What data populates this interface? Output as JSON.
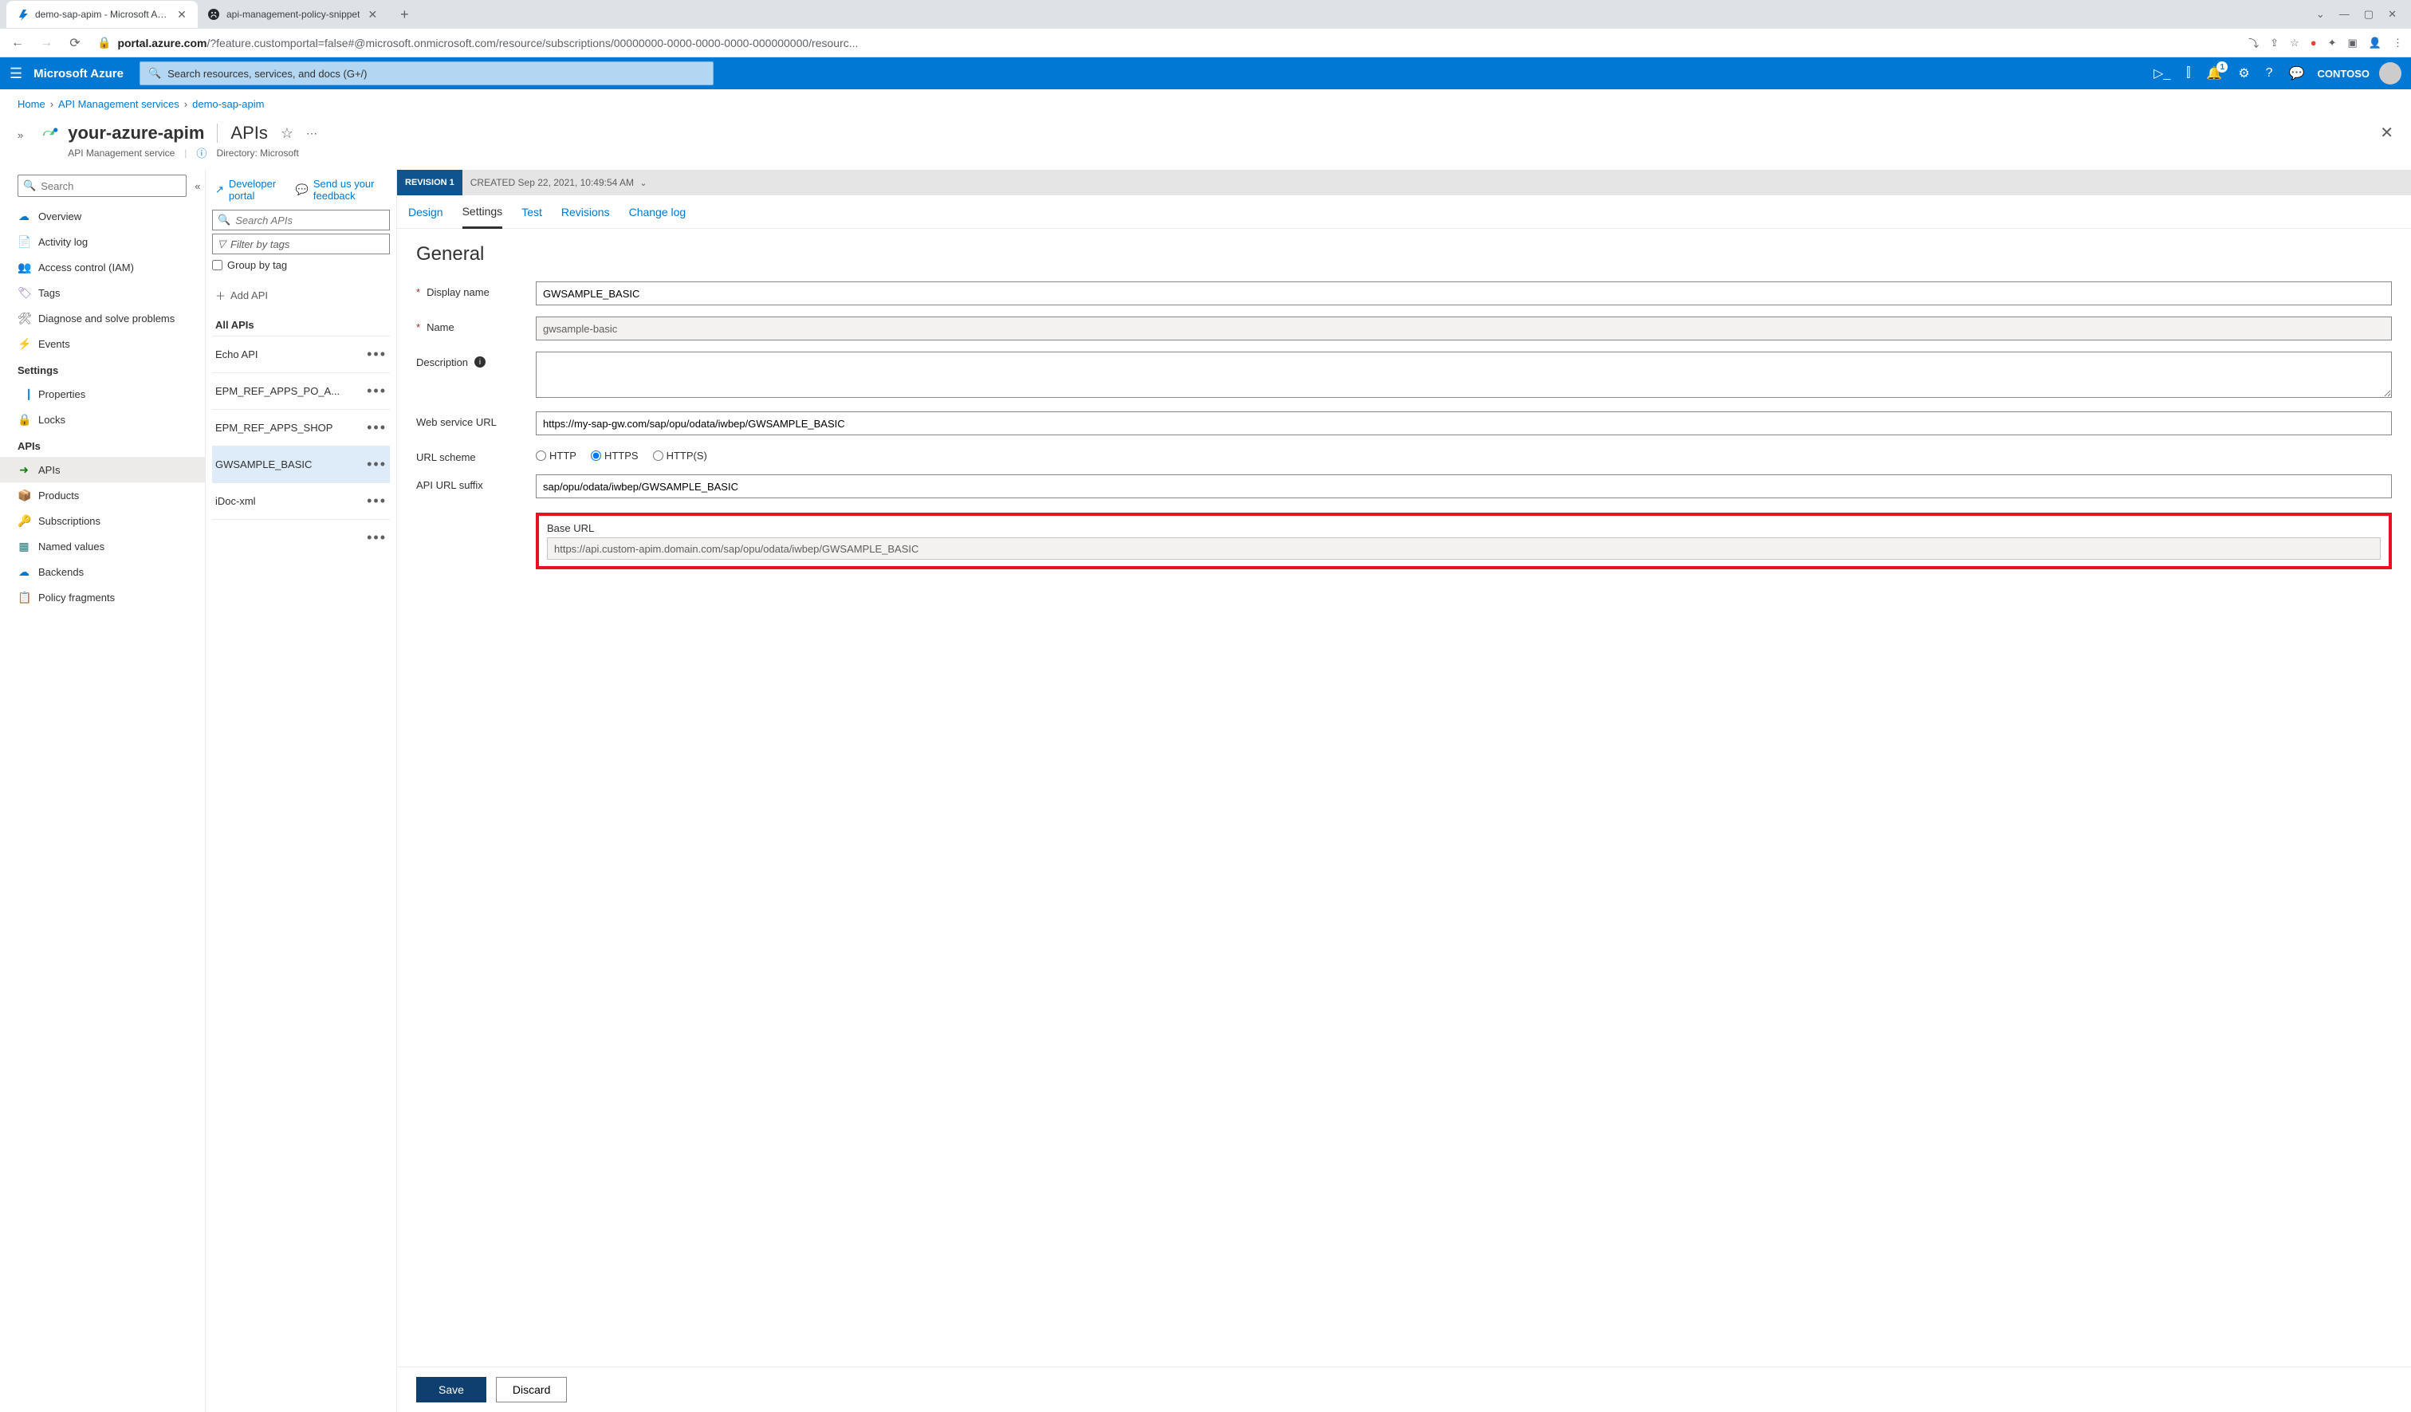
{
  "browser": {
    "tabs": [
      {
        "title": "demo-sap-apim - Microsoft Azur",
        "favicon": "azure"
      },
      {
        "title": "api-management-policy-snippet",
        "favicon": "github"
      }
    ],
    "url_host": "portal.azure.com",
    "url_rest": "/?feature.customportal=false#@microsoft.onmicrosoft.com/resource/subscriptions/00000000-0000-0000-0000-000000000/resourc..."
  },
  "azure": {
    "brand": "Microsoft Azure",
    "search_placeholder": "Search resources, services, and docs (G+/)",
    "notifications_badge": "1",
    "tenant": "CONTOSO"
  },
  "breadcrumb": {
    "items": [
      "Home",
      "API Management services",
      "demo-sap-apim"
    ]
  },
  "resource": {
    "name": "your-azure-apim",
    "section": "APIs",
    "type": "API Management service",
    "directory_label": "Directory: Microsoft"
  },
  "sidebar": {
    "search_placeholder": "Search",
    "top": [
      {
        "label": "Overview",
        "icon": "☁",
        "cls": "blue"
      },
      {
        "label": "Activity log",
        "icon": "📄",
        "cls": "blue"
      },
      {
        "label": "Access control (IAM)",
        "icon": "👥",
        "cls": "blue"
      },
      {
        "label": "Tags",
        "icon": "🏷",
        "cls": "purple"
      },
      {
        "label": "Diagnose and solve problems",
        "icon": "🛠",
        "cls": "gray"
      },
      {
        "label": "Events",
        "icon": "⚡",
        "cls": "orange"
      }
    ],
    "group_settings": "Settings",
    "settings": [
      {
        "label": "Properties",
        "icon": "⎹⎸",
        "cls": "blue"
      },
      {
        "label": "Locks",
        "icon": "🔒",
        "cls": "blue"
      }
    ],
    "group_apis": "APIs",
    "apis": [
      {
        "label": "APIs",
        "icon": "➜",
        "cls": "green",
        "active": true
      },
      {
        "label": "Products",
        "icon": "📦",
        "cls": "blue"
      },
      {
        "label": "Subscriptions",
        "icon": "🔑",
        "cls": "yellow"
      },
      {
        "label": "Named values",
        "icon": "▦",
        "cls": "teal"
      },
      {
        "label": "Backends",
        "icon": "☁",
        "cls": "blue"
      },
      {
        "label": "Policy fragments",
        "icon": "📋",
        "cls": "gray"
      }
    ]
  },
  "mid": {
    "dev_portal": "Developer portal",
    "feedback": "Send us your feedback",
    "search_placeholder": "Search APIs",
    "filter_placeholder": "Filter by tags",
    "group_label": "Group by tag",
    "add_api": "Add API",
    "all_apis": "All APIs",
    "apis": [
      "Echo API",
      "EPM_REF_APPS_PO_A...",
      "EPM_REF_APPS_SHOP",
      "GWSAMPLE_BASIC",
      "iDoc-xml"
    ],
    "selected_index": 3
  },
  "detail": {
    "revision_label": "REVISION 1",
    "created_label": "CREATED Sep 22, 2021, 10:49:54 AM",
    "tabs": [
      "Design",
      "Settings",
      "Test",
      "Revisions",
      "Change log"
    ],
    "active_tab_index": 1,
    "general": {
      "title": "General",
      "labels": {
        "display_name": "Display name",
        "name": "Name",
        "description": "Description",
        "web_service_url": "Web service URL",
        "url_scheme": "URL scheme",
        "api_url_suffix": "API URL suffix",
        "base_url": "Base URL"
      },
      "values": {
        "display_name": "GWSAMPLE_BASIC",
        "name": "gwsample-basic",
        "description": "",
        "web_service_url": "https://my-sap-gw.com/sap/opu/odata/iwbep/GWSAMPLE_BASIC",
        "api_url_suffix": "sap/opu/odata/iwbep/GWSAMPLE_BASIC",
        "base_url": "https://api.custom-apim.domain.com/sap/opu/odata/iwbep/GWSAMPLE_BASIC"
      },
      "scheme_options": [
        "HTTP",
        "HTTPS",
        "HTTP(S)"
      ],
      "scheme_selected": "HTTPS"
    },
    "buttons": {
      "save": "Save",
      "discard": "Discard"
    }
  }
}
